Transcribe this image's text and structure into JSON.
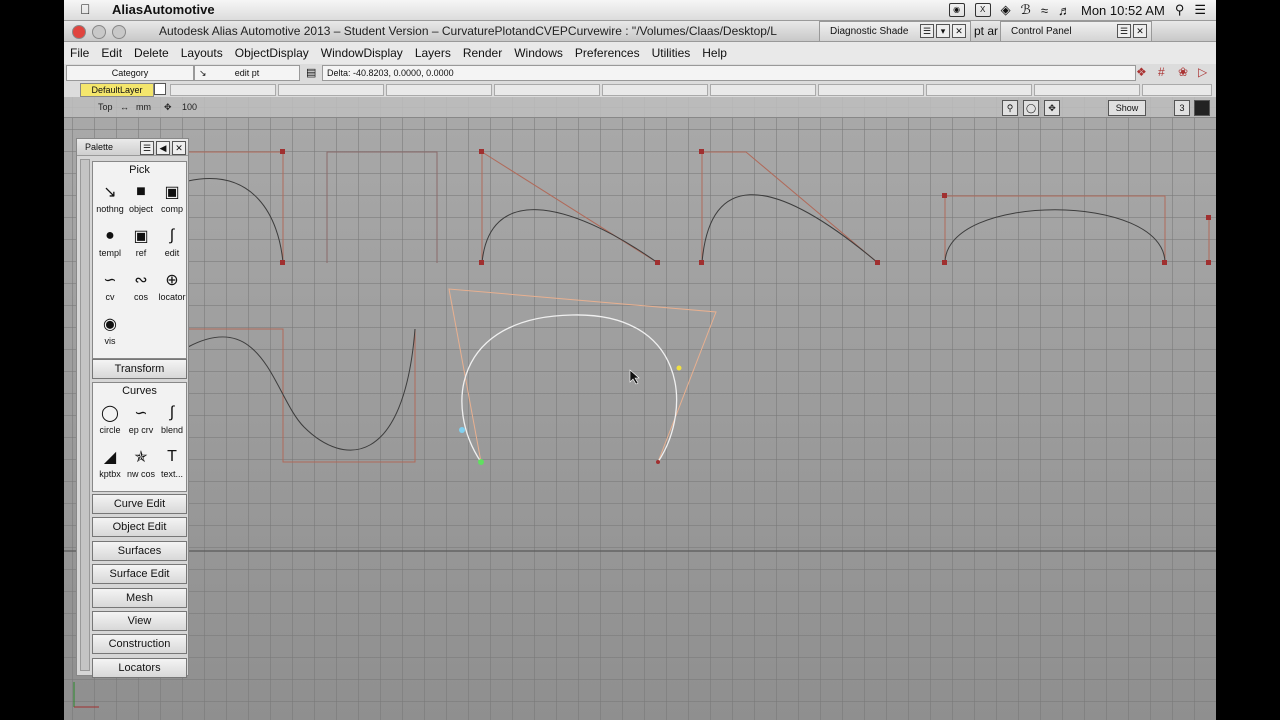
{
  "os_menubar": {
    "app_name": "AliasAutomotive",
    "clock": "Mon 10:52 AM"
  },
  "window": {
    "title": "Autodesk Alias Automotive 2013 – Student Version – CurvaturePlotandCVEPCurvewire : \"/Volumes/Claas/Desktop/L",
    "title_tail": "pt ar",
    "diagnostic_shade_label": "Diagnostic Shade",
    "control_panel_label": "Control Panel"
  },
  "menu": [
    "File",
    "Edit",
    "Delete",
    "Layouts",
    "ObjectDisplay",
    "WindowDisplay",
    "Layers",
    "Render",
    "Windows",
    "Preferences",
    "Utilities",
    "Help"
  ],
  "toolbar": {
    "category": "Category",
    "tool_name": "edit pt",
    "delta": "Delta:  -40.8203, 0.0000, 0.0000"
  },
  "layers": {
    "default_layer": "DefaultLayer"
  },
  "viewport": {
    "view_name": "Top",
    "units": "mm",
    "grid_value": "100",
    "show_button": "Show",
    "count": "3"
  },
  "palette": {
    "title": "Palette",
    "pick": {
      "header": "Pick",
      "tools": [
        "nothng",
        "object",
        "comp",
        "templ",
        "ref",
        "edit",
        "cv",
        "cos",
        "locator",
        "vis"
      ]
    },
    "transform_label": "Transform",
    "curves": {
      "header": "Curves",
      "tools": [
        "circle",
        "ep crv",
        "blend",
        "kptbx",
        "nw cos",
        "text..."
      ]
    },
    "buttons": [
      "Curve Edit",
      "Object Edit",
      "Surfaces",
      "Surface Edit",
      "Mesh",
      "View",
      "Construction",
      "Locators"
    ]
  },
  "colors": {
    "viewport_bg": "#9c9c9c",
    "curve": "#3c3c3c",
    "hull": "#b06a5a",
    "cv_point": "#a03030",
    "selected_curve": "#f0f0f0",
    "selected_hull": "#e8b090",
    "default_layer": "#f4e66c"
  }
}
